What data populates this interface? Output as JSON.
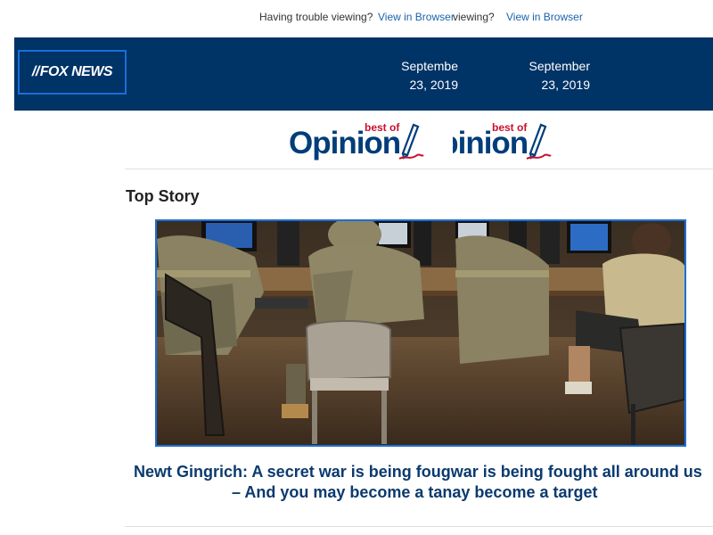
{
  "topbar": {
    "trouble_text_1": "Having trouble viewing?",
    "view_link_1": "View in Browser",
    "trouble_text_2": "viewing?",
    "view_link_2": "View in Browser"
  },
  "header": {
    "logo_text": "FOX NEWS",
    "date_1": "Septembe 23, 2019",
    "date_2": "September 23, 2019",
    "bg_color": "#003366"
  },
  "banner": {
    "opinion_word": "Opinion",
    "best_of": "best of",
    "opinion_word_cropped": "inion"
  },
  "main": {
    "section_title": "Top Story",
    "image_alt": "Soldiers seated at computer workstations",
    "headline_line1": "Newt Gingrich: A secret war is being fougwar is being fought all around us",
    "headline_line2": "– And you may become a tanay become a target"
  },
  "colors": {
    "accent_blue": "#1a6fd8",
    "link_blue": "#1b62ad",
    "opinion_red": "#c8102e",
    "headline_blue": "#0b3a6f"
  }
}
